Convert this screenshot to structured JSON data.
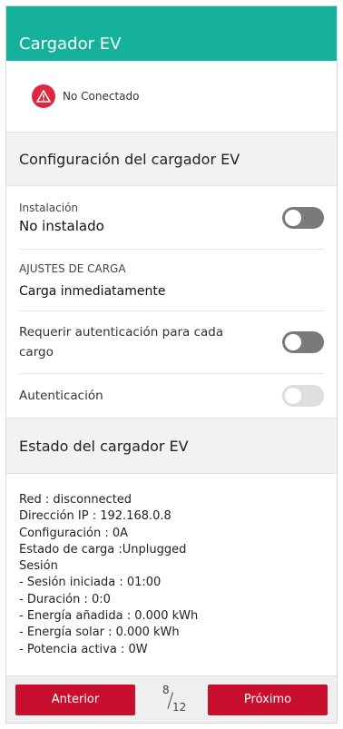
{
  "app": {
    "title": "Cargador EV"
  },
  "status": {
    "text": "No Conectado",
    "icon": "warning-icon",
    "color": "#e0273e"
  },
  "config": {
    "header": "Configuración del cargador EV",
    "installation_label": "Instalación",
    "installation_value": "No instalado",
    "charge_settings_label": "AJUSTES DE CARGA",
    "charge_settings_value": "Carga inmediatamente",
    "require_auth_label": "Requerir autenticación para cada cargo",
    "auth_label": "Autenticación",
    "toggles": {
      "installation": false,
      "require_auth": false,
      "auth": false
    }
  },
  "state": {
    "header": "Estado del cargador EV",
    "lines": [
      "Red : disconnected",
      "Dirección IP : 192.168.0.8",
      "Configuración : 0A",
      "Estado de carga :Unplugged",
      "Sesión",
      "- Sesión iniciada : 01:00",
      "- Duración : 0:0",
      "- Energía añadida : 0.000 kWh",
      "- Energía solar : 0.000 kWh",
      "- Potencia activa : 0W"
    ]
  },
  "footer": {
    "prev_label": "Anterior",
    "next_label": "Próximo",
    "page_current": "8",
    "page_total": "12",
    "page_sep": "/"
  },
  "colors": {
    "accent": "#15b19b",
    "button": "#c8102e"
  }
}
